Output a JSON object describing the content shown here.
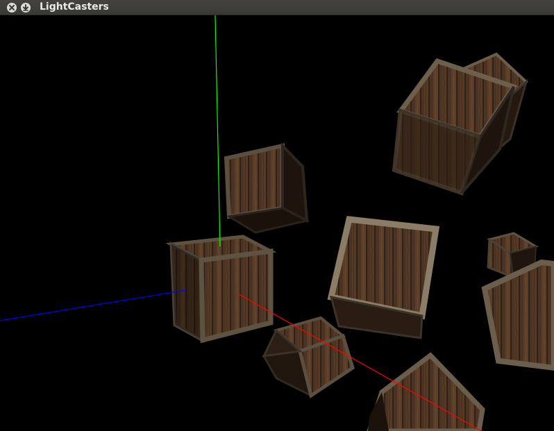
{
  "window": {
    "title": "LightCasters",
    "buttons": [
      {
        "name": "close-button",
        "icon": "close-icon"
      },
      {
        "name": "minimize-button",
        "icon": "minimize-icon"
      }
    ]
  },
  "scene": {
    "background": "#000000",
    "axis_colors": {
      "x": "#ff0000",
      "y": "#00ff00",
      "z": "#0000ff"
    },
    "object_texture": "wooden-crate",
    "wood_colors": {
      "light": "#6a4a30",
      "dark": "#2e1f14",
      "frame": "#5d5040",
      "frame_shade": "#3a3229"
    }
  }
}
